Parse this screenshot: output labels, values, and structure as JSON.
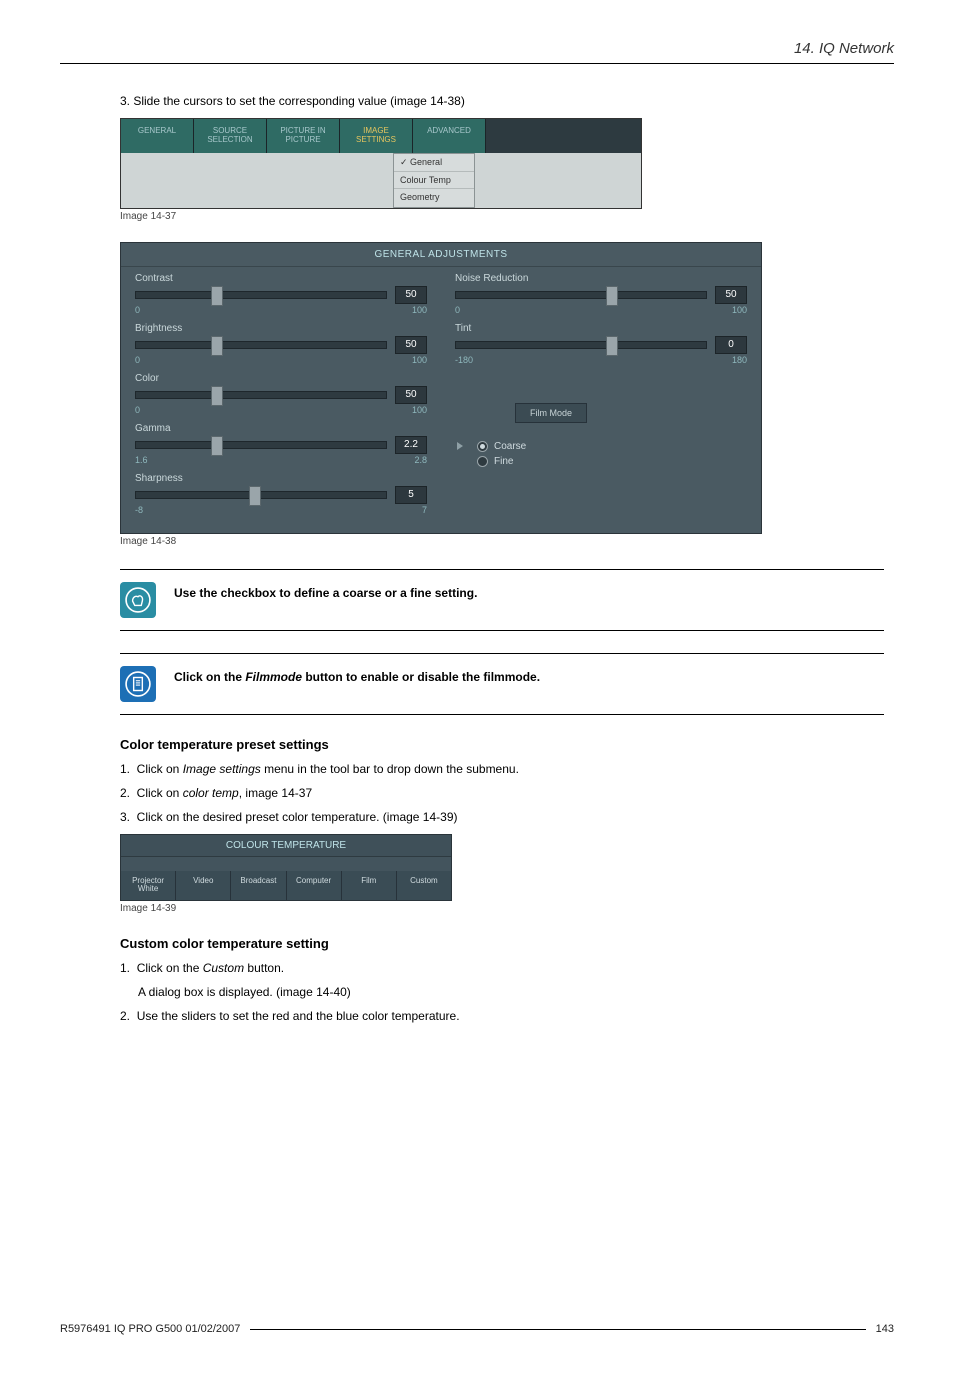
{
  "header": {
    "title": "14.  IQ Network"
  },
  "intro_step": "3.  Slide the cursors to set the corresponding value (image 14-38)",
  "img37": {
    "caption": "Image 14-37",
    "tabs": [
      "GENERAL",
      "SOURCE SELECTION",
      "PICTURE IN PICTURE",
      "IMAGE SETTINGS",
      "ADVANCED"
    ],
    "active_tab_index": 3,
    "dropdown": [
      "General",
      "Colour Temp",
      "Geometry"
    ]
  },
  "img38": {
    "caption": "Image 14-38",
    "panel_title": "GENERAL ADJUSTMENTS",
    "left_sliders": [
      {
        "label": "Contrast",
        "value": "50",
        "min": "0",
        "max": "100",
        "pos": 30
      },
      {
        "label": "Brightness",
        "value": "50",
        "min": "0",
        "max": "100",
        "pos": 30
      },
      {
        "label": "Color",
        "value": "50",
        "min": "0",
        "max": "100",
        "pos": 30
      },
      {
        "label": "Gamma",
        "value": "2.2",
        "min": "1.6",
        "max": "2.8",
        "pos": 30
      },
      {
        "label": "Sharpness",
        "value": "5",
        "min": "-8",
        "max": "7",
        "pos": 45
      }
    ],
    "right_sliders": [
      {
        "label": "Noise Reduction",
        "value": "50",
        "min": "0",
        "max": "100",
        "pos": 60
      },
      {
        "label": "Tint",
        "value": "0",
        "min": "-180",
        "max": "180",
        "pos": 60
      }
    ],
    "film_button": "Film Mode",
    "radio_coarse": "Coarse",
    "radio_fine": "Fine"
  },
  "note1": {
    "text": "Use the checkbox to define a coarse or a fine setting."
  },
  "note2": {
    "prefix": "Click on the ",
    "em": "Filmmode",
    "suffix": " button to enable or disable the filmmode."
  },
  "section_ct_preset": {
    "heading": "Color temperature preset settings",
    "steps_plain": [
      {
        "n": "1.",
        "before": "Click on ",
        "em": "Image settings",
        "after": " menu in the tool bar to drop down the submenu."
      },
      {
        "n": "2.",
        "before": "Click on ",
        "em": "color temp",
        "after": ", image 14-37"
      },
      {
        "n": "3.",
        "before": "Click on the desired preset color temperature.  (image 14-39)",
        "em": "",
        "after": ""
      }
    ]
  },
  "img39": {
    "caption": "Image 14-39",
    "panel_title": "COLOUR TEMPERATURE",
    "buttons": [
      "Projector White",
      "Video",
      "Broadcast",
      "Computer",
      "Film",
      "Custom"
    ]
  },
  "section_ct_custom": {
    "heading": "Custom color temperature setting",
    "step1_before": "Click on the ",
    "step1_em": "Custom",
    "step1_after": " button.",
    "step1_sub": "A dialog box is displayed.  (image 14-40)",
    "step2": "Use the sliders to set the red and the blue color temperature."
  },
  "footer": {
    "left": "R5976491  IQ PRO G500  01/02/2007",
    "right": "143"
  }
}
